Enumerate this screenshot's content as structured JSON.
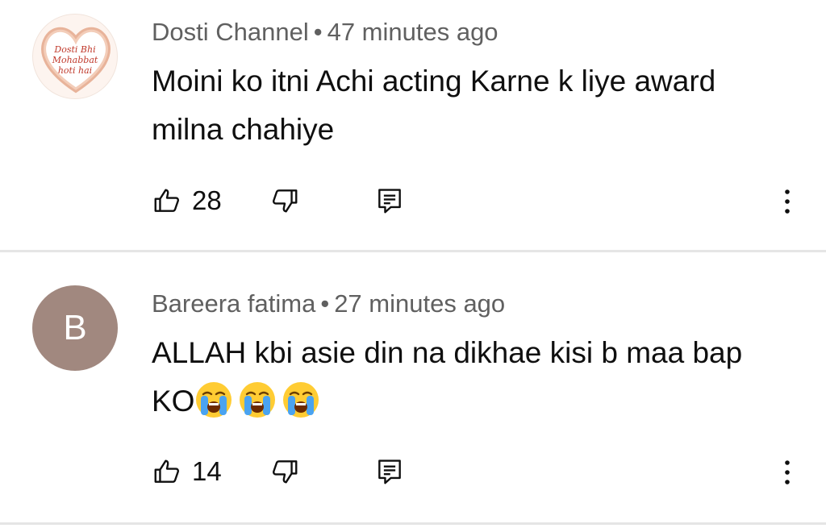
{
  "comments": [
    {
      "author": "Dosti Channel",
      "separator": "•",
      "time": "47 minutes ago",
      "text": "Moini ko itni Achi acting Karne k liye award milna chahiye",
      "likes": "28",
      "avatar": {
        "type": "image",
        "lines": [
          "Dosti Bhi",
          "Mohabbat",
          "hoti hai"
        ]
      }
    },
    {
      "author": "Bareera fatima",
      "separator": "•",
      "time": "27 minutes ago",
      "text": "ALLAH kbi asie din na dikhae kisi b maa bap KO",
      "emoji_count": 3,
      "likes": "14",
      "avatar": {
        "type": "letter",
        "letter": "B",
        "color": "#a1887f"
      }
    }
  ],
  "icons": {
    "like": "thumbs-up-icon",
    "dislike": "thumbs-down-icon",
    "reply": "reply-comment-icon",
    "more": "more-vertical-icon",
    "emoji": "loudly-crying-face-emoji"
  }
}
